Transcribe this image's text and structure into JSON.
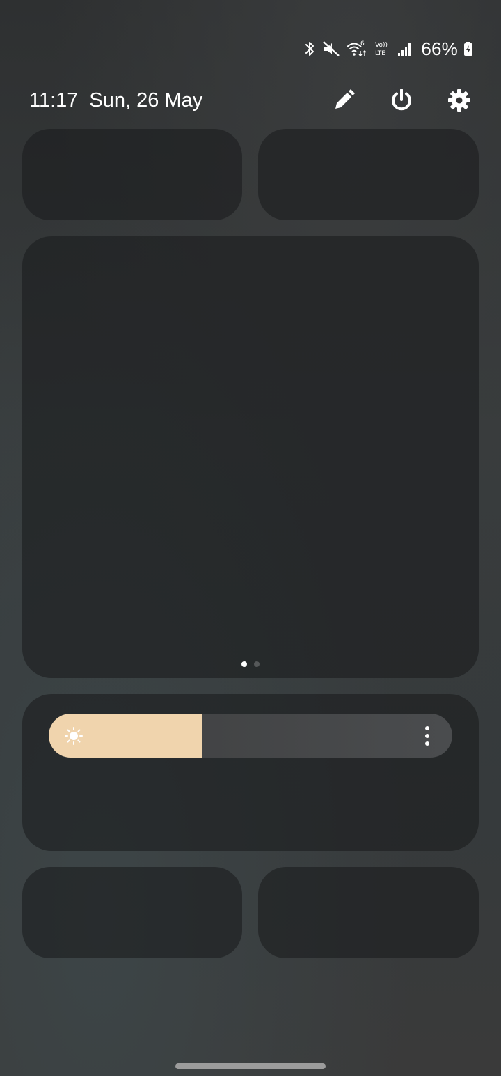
{
  "status_bar": {
    "battery": "66%",
    "icons": [
      "bluetooth-icon",
      "mute-icon",
      "wifi-6-icon",
      "volte-lte-icon",
      "signal-icon",
      "battery-charging-icon"
    ],
    "wifi_badge": "6",
    "volte_top": "Vo))",
    "volte_bottom": "LTE"
  },
  "header": {
    "time": "11:17",
    "date": "Sun, 26 May",
    "actions": [
      "edit-icon",
      "power-icon",
      "settings-icon"
    ]
  },
  "main_panel": {
    "page_count": 2,
    "active_page": 1
  },
  "brightness": {
    "level": 0.38,
    "icon": "sun-icon",
    "more_icon": "more-vertical-icon"
  },
  "colors": {
    "slider_fill": "#f0d4ad",
    "tile_bg": "#1c1d1e"
  }
}
